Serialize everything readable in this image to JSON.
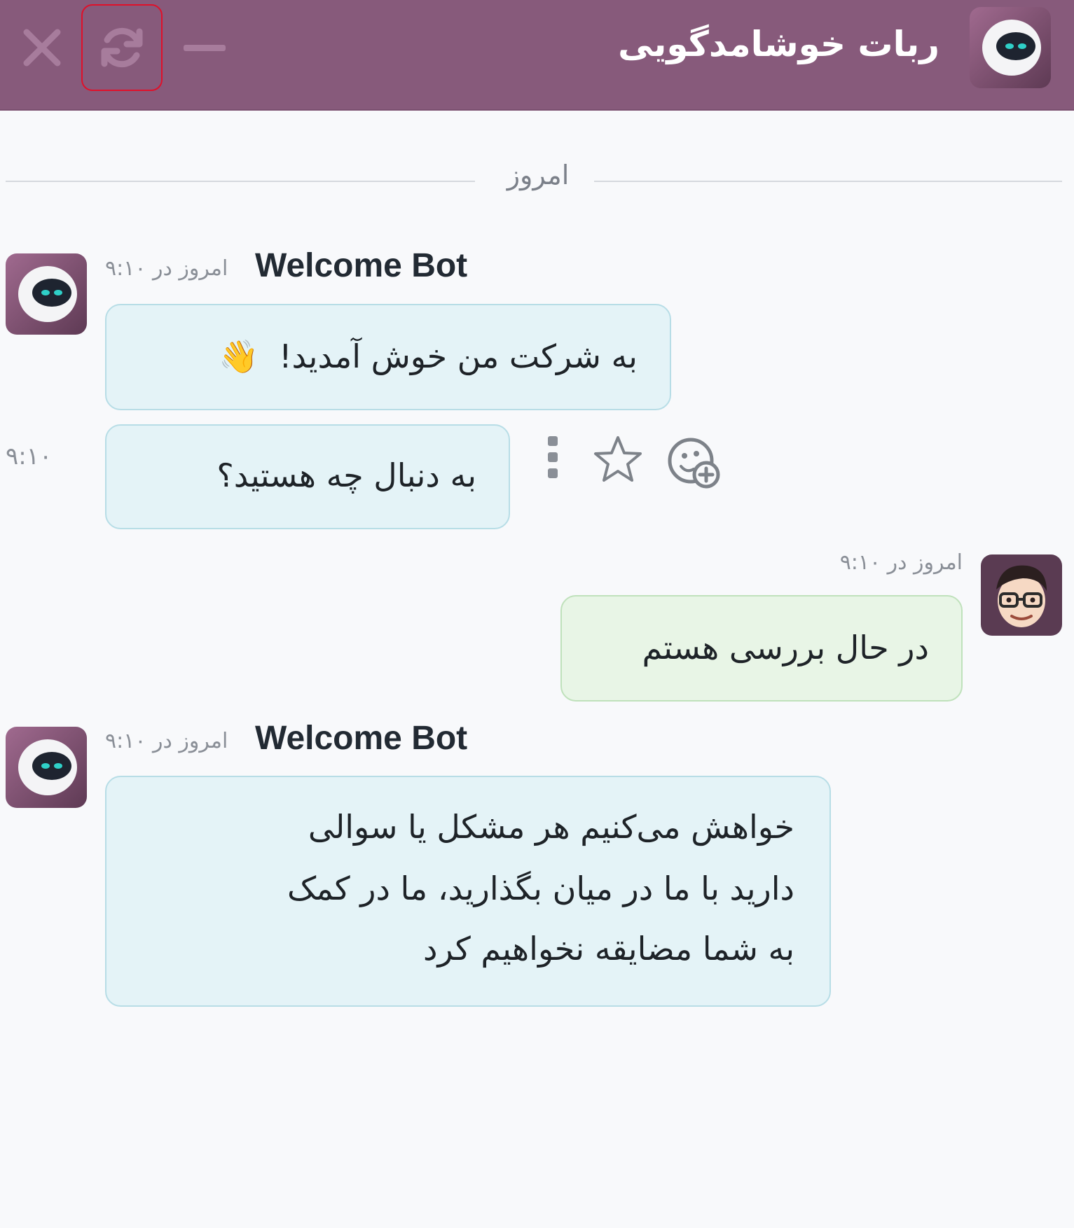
{
  "header": {
    "title": "ربات خوشامدگویی",
    "bg_color": "#875a7b",
    "icons": [
      "close-icon",
      "refresh-icon",
      "minimize-icon"
    ]
  },
  "date_separator": "امروز",
  "messages": [
    {
      "author": "Welcome Bot",
      "meta": "امروز در ۹:۱۰",
      "text": "به شرکت من خوش آمدید!",
      "emoji": "👋"
    },
    {
      "time": "۹:۱۰",
      "text": "به دنبال چه هستید؟",
      "actions": [
        "more-icon",
        "star-icon",
        "add-reaction-icon"
      ]
    },
    {
      "meta": "امروز در ۹:۱۰",
      "text": "در حال بررسی هستم"
    },
    {
      "author": "Welcome Bot",
      "meta": "امروز در ۹:۱۰",
      "lines": [
        "خواهش می‌کنیم هر مشکل یا سوالی",
        "دارید با ما در میان بگذارید، ما در کمک",
        "به شما مضایقه نخواهیم کرد"
      ]
    }
  ],
  "colors": {
    "bot_bubble": "#e4f3f7",
    "user_bubble": "#e8f5e6",
    "highlight": "#e0102a"
  }
}
